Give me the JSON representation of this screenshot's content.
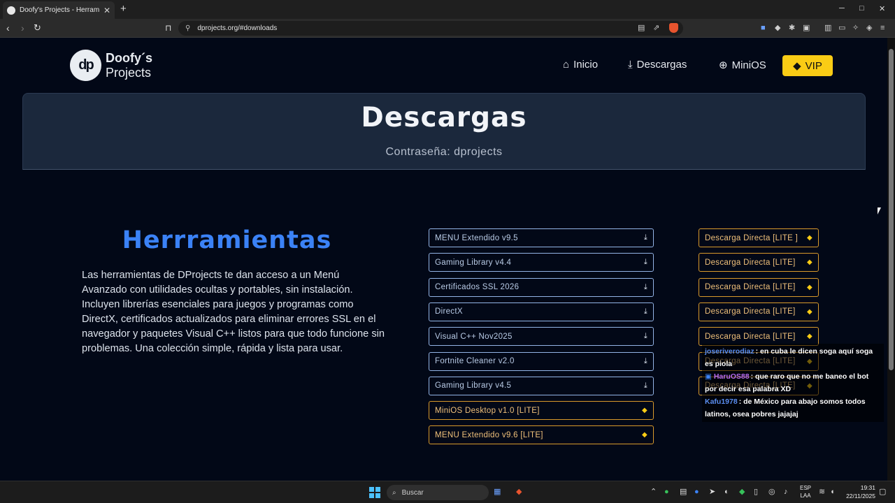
{
  "browser": {
    "tab_title": "Doofy's Projects - Herramientas",
    "url": "dprojects.org/#downloads",
    "new_tab": "+",
    "min": "─",
    "max": "□",
    "close": "✕"
  },
  "header": {
    "logo_line1": "Doofy´s",
    "logo_line2": "Projects",
    "logo_mark": "dp",
    "nav": [
      {
        "label": "Inicio",
        "icon": "home-icon"
      },
      {
        "label": "Descargas",
        "icon": "download-icon"
      },
      {
        "label": "MiniOS",
        "icon": "globe-icon"
      }
    ],
    "vip_label": "VIP"
  },
  "hero": {
    "title": "Descargas",
    "password": "Contraseña: dprojects"
  },
  "section": {
    "title": "Herrramientas",
    "description": "Las herramientas de DProjects te dan acceso a un Menú Avanzado con utilidades ocultas y portables, sin instalación. Incluyen librerías esenciales para juegos y programas como DirectX, certificados actualizados para eliminar errores SSL en el navegador y paquetes Visual C++ listos para que todo funcione sin problemas. Una colección simple, rápida y lista para usar."
  },
  "downloads": [
    {
      "label": "MENU Extendido v9.5",
      "type": "free"
    },
    {
      "label": "Gaming Library v4.4",
      "type": "free"
    },
    {
      "label": "Certificados SSL 2026",
      "type": "free"
    },
    {
      "label": "DirectX",
      "type": "free"
    },
    {
      "label": "Visual C++ Nov2025",
      "type": "free"
    },
    {
      "label": "Fortnite Cleaner v2.0",
      "type": "free"
    },
    {
      "label": "Gaming Library v4.5",
      "type": "free"
    },
    {
      "label": "MiniOS Desktop v1.0 [LITE]",
      "type": "lite"
    },
    {
      "label": "MENU Extendido v9.6 [LITE]",
      "type": "lite"
    }
  ],
  "direct_downloads": [
    "Descarga Directa [LITE ]",
    "Descarga Directa [LITE]",
    "Descarga Directa [LITE]",
    "Descarga Directa [LITE]",
    "Descarga Directa [LITE]",
    "Descarga Directa [LITE]",
    "Descarga Directa [LITE]"
  ],
  "chat": [
    {
      "user": "joseriverodiaz",
      "color": "#5b8ef0",
      "text": ": en cuba le dicen soga aquí soga es piola"
    },
    {
      "user": "HaruOS88",
      "color": "#b86bf0",
      "text": ": que raro que no me baneo el bot por decir esa palabra XD"
    },
    {
      "user": "Kafu1978",
      "color": "#5b8ef0",
      "text": ": de México para abajo somos todos latinos, osea pobres jajajaj"
    }
  ],
  "taskbar": {
    "search_placeholder": "Buscar",
    "lang_line1": "ESP",
    "lang_line2": "LAA",
    "time": "19:31",
    "date": "22/11/2025"
  },
  "colors": {
    "page_bg": "#020817",
    "accent_blue": "#3b82f6",
    "vip_yellow": "#facc15",
    "lite_orange": "#d99a2b"
  }
}
